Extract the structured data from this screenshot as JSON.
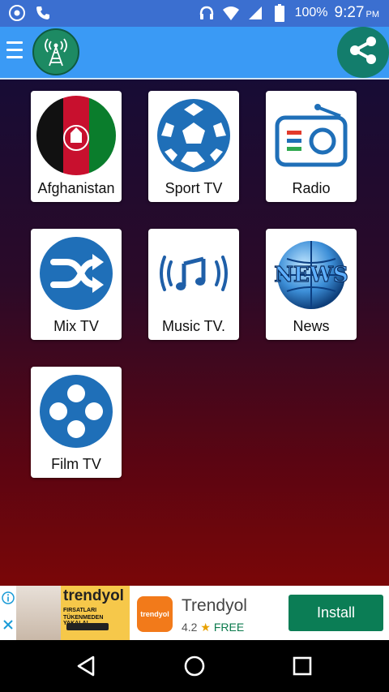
{
  "status_bar": {
    "icons_left": [
      "chrome-icon",
      "phone-icon"
    ],
    "icons_right": [
      "headphones-icon",
      "wifi-icon",
      "signal-icon",
      "battery-icon"
    ],
    "battery": "100%",
    "time": "9:27",
    "ampm": "PM"
  },
  "app_bar": {
    "menu_icon": "hamburger-menu-icon",
    "logo_icon": "radio-tower-icon",
    "share_icon": "share-icon",
    "colors": {
      "bar": "#3a9af5",
      "logo": "#1d8a63",
      "share": "#137d6c"
    }
  },
  "tiles": [
    {
      "label": "Afghanistan",
      "icon": "afghanistan-flag-icon"
    },
    {
      "label": "Sport TV",
      "icon": "soccer-ball-icon"
    },
    {
      "label": "Radio",
      "icon": "radio-icon"
    },
    {
      "label": "Mix TV",
      "icon": "shuffle-icon"
    },
    {
      "label": "Music TV.",
      "icon": "music-note-broadcast-icon"
    },
    {
      "label": "News",
      "icon": "news-globe-icon"
    },
    {
      "label": "Film TV",
      "icon": "film-reel-icon"
    }
  ],
  "ad": {
    "banner_brand": "trendyol",
    "banner_line1": "FIRSATLARI",
    "banner_line2": "TÜKENMEDEN YAKALA!",
    "app_icon_text": "trendyol",
    "app_name": "Trendyol",
    "rating": "4.2",
    "price": "FREE",
    "install_label": "Install"
  },
  "nav_bar": {
    "back": "back-icon",
    "home": "home-icon",
    "recents": "recents-icon"
  }
}
